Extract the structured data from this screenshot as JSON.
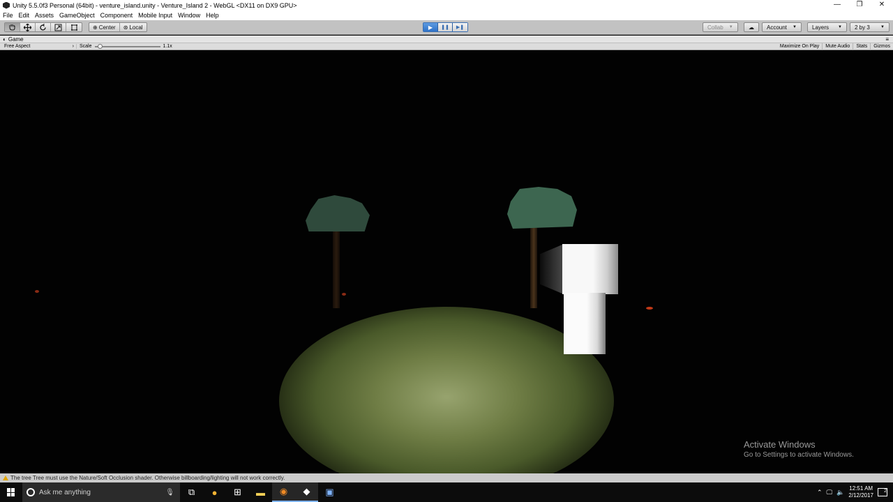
{
  "window": {
    "title": "Unity 5.5.0f3 Personal (64bit) - venture_island.unity - Venture_Island 2 - WebGL <DX11 on DX9 GPU>",
    "minimize": "—",
    "restore": "❐",
    "close": "✕"
  },
  "menu": [
    "File",
    "Edit",
    "Assets",
    "GameObject",
    "Component",
    "Mobile Input",
    "Window",
    "Help"
  ],
  "toolbar": {
    "tools": [
      "hand-icon",
      "move-icon",
      "rotate-icon",
      "scale-icon",
      "rect-icon"
    ],
    "pivot_center": "Center",
    "pivot_local": "Local",
    "play": "▶",
    "pause": "❚❚",
    "step": "▶❚",
    "collab": "Collab",
    "account": "Account",
    "layers": "Layers",
    "layout": "2 by 3"
  },
  "game_tab": {
    "title": "Game",
    "aspect": "Free Aspect",
    "scale_label": "Scale",
    "scale_value": "1.1x",
    "maximize": "Maximize On Play",
    "mute": "Mute Audio",
    "stats": "Stats",
    "gizmos": "Gizmos"
  },
  "watermark": {
    "line1": "Activate Windows",
    "line2": "Go to Settings to activate Windows."
  },
  "status": {
    "message": "The tree Tree must use the Nature/Soft Occlusion shader. Otherwise billboarding/lighting will not work correctly."
  },
  "taskbar": {
    "search_placeholder": "Ask me anything",
    "time": "12:51 AM",
    "date": "2/12/2017",
    "notifications": "2"
  }
}
